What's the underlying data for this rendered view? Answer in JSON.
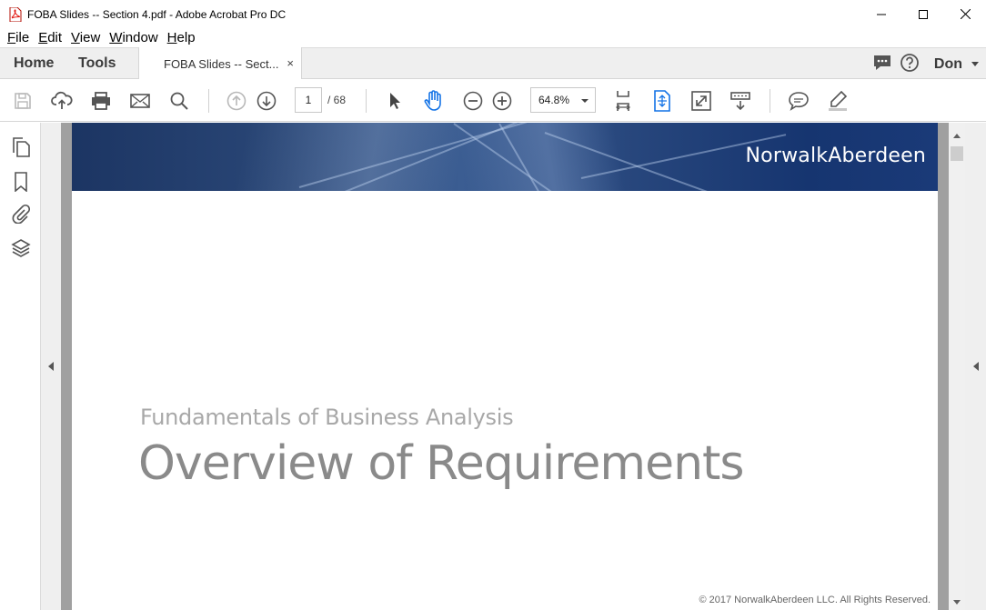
{
  "window": {
    "title": "FOBA Slides -- Section 4.pdf - Adobe Acrobat Pro DC",
    "controls": {
      "minimize": "minimize-icon",
      "maximize": "maximize-icon",
      "close": "close-icon"
    }
  },
  "menu": {
    "items": [
      {
        "key": "F",
        "rest": "ile"
      },
      {
        "key": "E",
        "rest": "dit"
      },
      {
        "key": "V",
        "rest": "iew"
      },
      {
        "key": "W",
        "rest": "indow"
      },
      {
        "key": "H",
        "rest": "elp"
      }
    ]
  },
  "tabs": {
    "home": "Home",
    "tools": "Tools",
    "document": "FOBA Slides -- Sect...",
    "document_close": "×",
    "user": "Don"
  },
  "toolbar": {
    "icons": [
      "save-icon",
      "cloud-upload-icon",
      "print-icon",
      "email-icon",
      "search-icon",
      "previous-page-icon",
      "next-page-icon",
      "select-tool-icon",
      "hand-tool-icon",
      "zoom-out-icon",
      "zoom-in-icon",
      "fit-width-icon",
      "fit-page-icon",
      "full-screen-icon",
      "scroll-mode-icon",
      "comment-icon",
      "highlight-icon"
    ],
    "current_page": "1",
    "page_total": "/ 68",
    "zoom": "64.8%"
  },
  "colors": {
    "accent_blue": "#1473e6",
    "banner_dark": "#1c3563",
    "title_grey": "#8a8a8a"
  },
  "slide": {
    "banner_logo": "NorwalkAberdeen",
    "subtitle": "Fundamentals of Business Analysis",
    "title": "Overview of Requirements",
    "copyright": "© 2017 NorwalkAberdeen LLC. All Rights Reserved."
  }
}
